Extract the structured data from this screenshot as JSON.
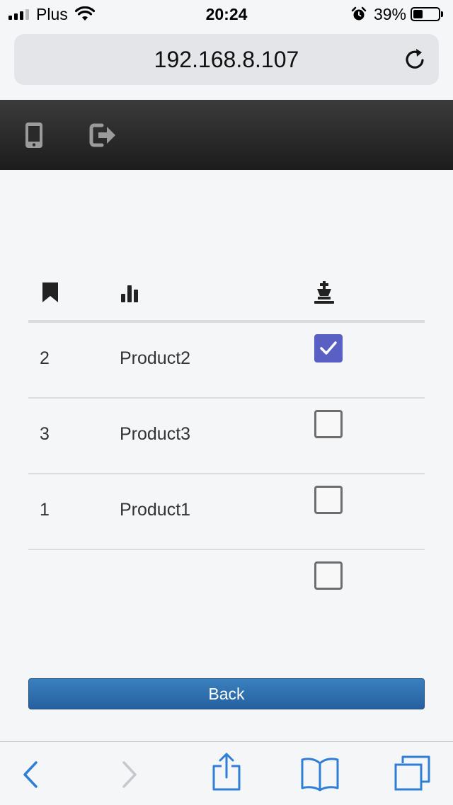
{
  "status_bar": {
    "carrier": "Plus",
    "time": "20:24",
    "battery_percent": "39%",
    "battery_level": 0.39,
    "icons": [
      "signal-icon",
      "wifi-icon",
      "alarm-icon",
      "battery-icon"
    ]
  },
  "browser": {
    "address": "192.168.8.107",
    "reload_icon": "reload-icon"
  },
  "header": {
    "icons": [
      "phone-icon",
      "logout-icon"
    ]
  },
  "table": {
    "columns": [
      {
        "icon": "bookmark-icon"
      },
      {
        "icon": "bar-chart-icon"
      },
      {
        "icon": "chess-king-icon"
      }
    ],
    "rows": [
      {
        "num": "2",
        "product": "Product2",
        "checked": true
      },
      {
        "num": "3",
        "product": "Product3",
        "checked": false
      },
      {
        "num": "1",
        "product": "Product1",
        "checked": false
      },
      {
        "num": "",
        "product": "",
        "checked": false
      }
    ]
  },
  "back_button": {
    "label": "Back"
  },
  "toolbar": {
    "icons": [
      "back-arrow-icon",
      "forward-arrow-icon",
      "share-icon",
      "bookmarks-icon",
      "tabs-icon"
    ],
    "accent": "#2f7fd6",
    "disabled": "#c5c8cc"
  },
  "colors": {
    "header_bg": "#262626",
    "checkbox_checked": "#5a5fc4",
    "button_bg": "#2d6aa8"
  }
}
